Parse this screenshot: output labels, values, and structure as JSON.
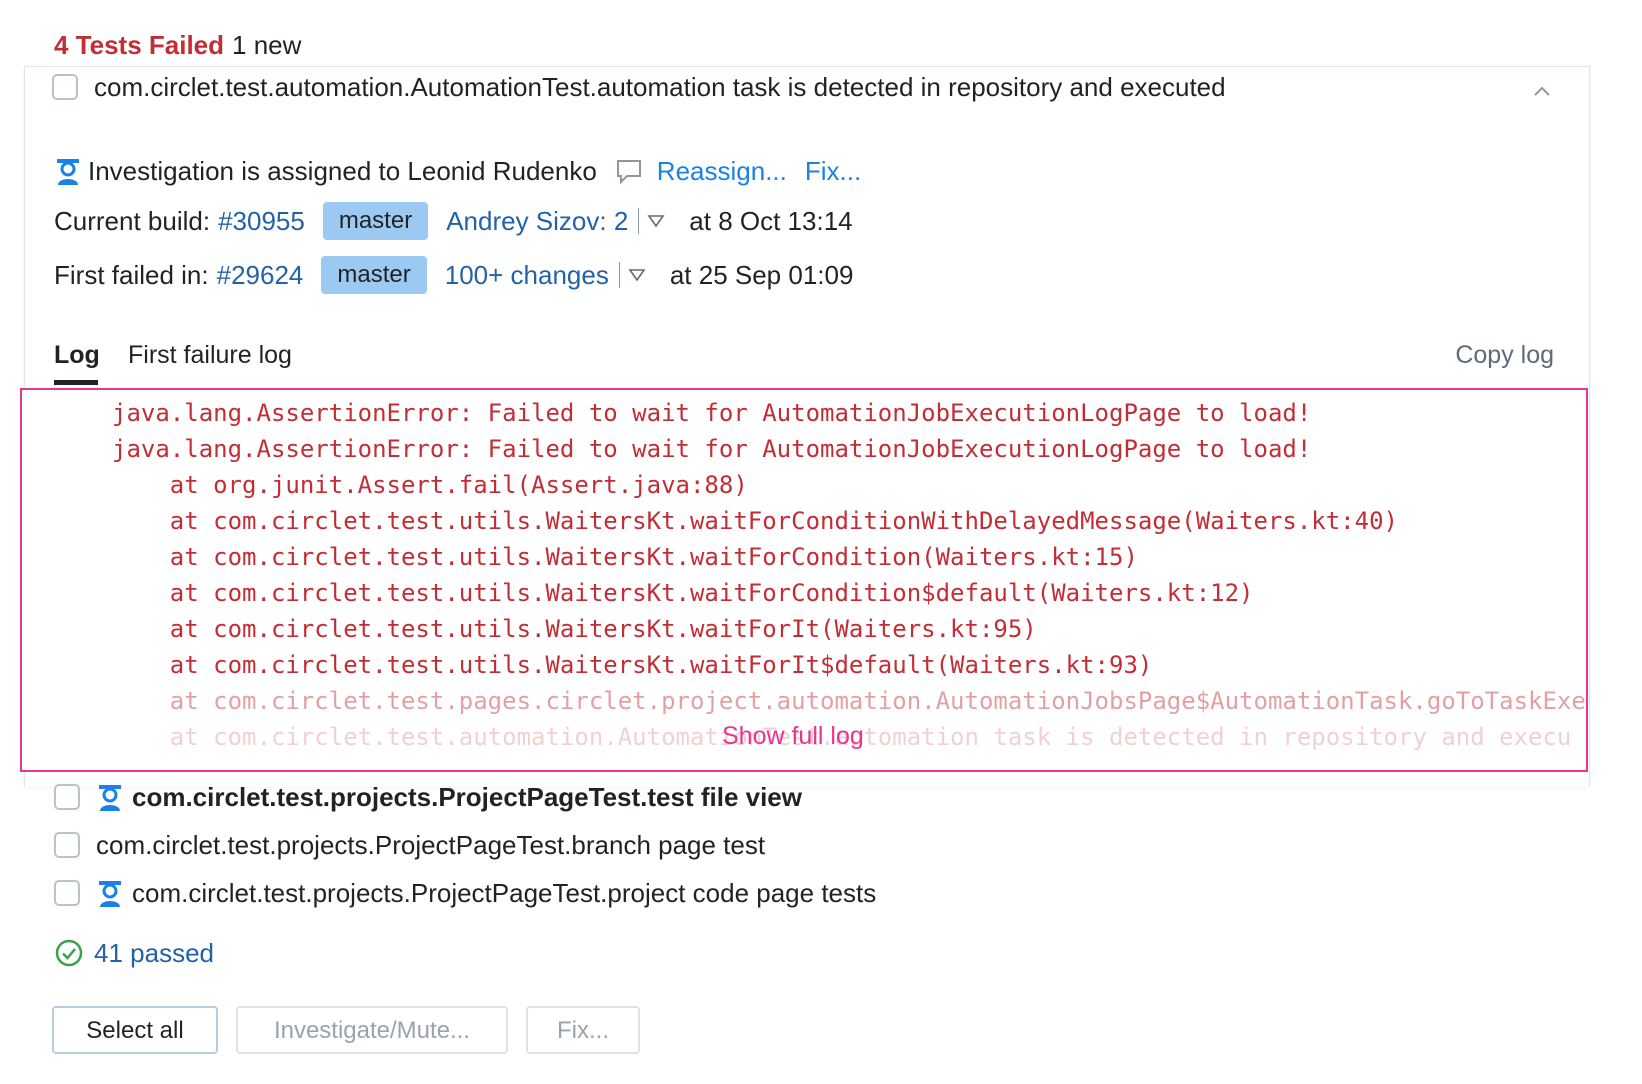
{
  "header": {
    "failed_label": "4 Tests Failed",
    "new_label": "1 new"
  },
  "expanded_test": {
    "name": "com.circlet.test.automation.AutomationTest.automation task is detected in repository and executed",
    "investigation_text": "Investigation is assigned to Leonid Rudenko",
    "reassign_label": "Reassign...",
    "fix_label": "Fix...",
    "current_build": {
      "label": "Current build:",
      "number": "#30955",
      "branch": "master",
      "changes": "Andrey Sizov: 2",
      "time": "at 8 Oct 13:14"
    },
    "first_failed": {
      "label": "First failed in:",
      "number": "#29624",
      "branch": "master",
      "changes": "100+ changes",
      "time": "at 25 Sep 01:09"
    },
    "tabs": [
      {
        "label": "Log",
        "active": true
      },
      {
        "label": "First failure log",
        "active": false
      }
    ],
    "copy_log_label": "Copy log",
    "log_lines": [
      "java.lang.AssertionError: Failed to wait for AutomationJobExecutionLogPage to load!",
      "java.lang.AssertionError: Failed to wait for AutomationJobExecutionLogPage to load!",
      "    at org.junit.Assert.fail(Assert.java:88)",
      "    at com.circlet.test.utils.WaitersKt.waitForConditionWithDelayedMessage(Waiters.kt:40)",
      "    at com.circlet.test.utils.WaitersKt.waitForCondition(Waiters.kt:15)",
      "    at com.circlet.test.utils.WaitersKt.waitForCondition$default(Waiters.kt:12)",
      "    at com.circlet.test.utils.WaitersKt.waitForIt(Waiters.kt:95)",
      "    at com.circlet.test.utils.WaitersKt.waitForIt$default(Waiters.kt:93)",
      "    at com.circlet.test.pages.circlet.project.automation.AutomationJobsPage$AutomationTask.goToTaskExe",
      "    at com.circlet.test.automation.AutomationTest.automation task is detected in repository and execu"
    ],
    "show_full_log_label": "Show full log",
    "colors": {
      "error_red": "#c22e36",
      "highlight_pink": "#e6378f",
      "badge_blue": "#9cc9f2"
    }
  },
  "other_tests": [
    {
      "name": "com.circlet.test.projects.ProjectPageTest.test file view",
      "investigated": true,
      "bold": true
    },
    {
      "name": "com.circlet.test.projects.ProjectPageTest.branch page test",
      "investigated": false,
      "bold": false
    },
    {
      "name": "com.circlet.test.projects.ProjectPageTest.project code page tests",
      "investigated": true,
      "bold": false
    }
  ],
  "passed_label": "41 passed",
  "buttons": {
    "select_all": "Select all",
    "investigate_mute": "Investigate/Mute...",
    "fix": "Fix..."
  }
}
